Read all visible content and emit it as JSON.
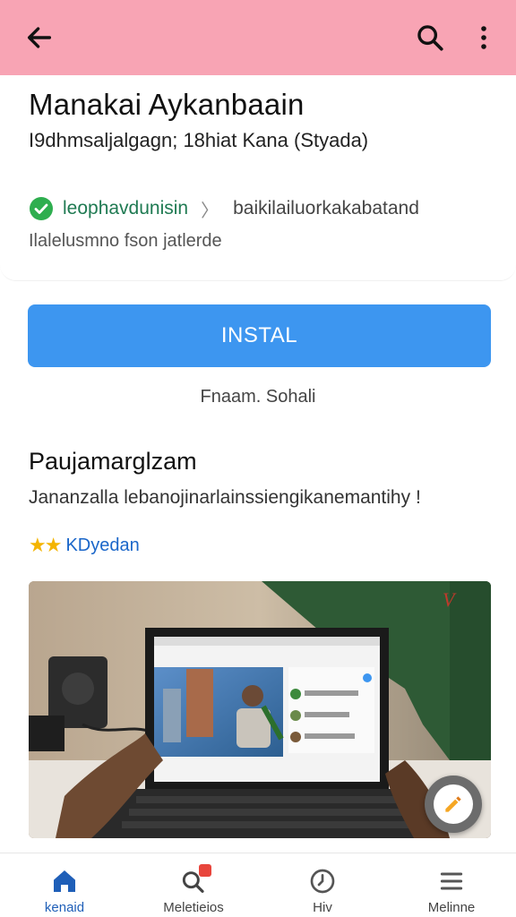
{
  "appbar": {
    "back_icon": "arrow-left-icon",
    "search_icon": "search-icon",
    "more_icon": "more-vertical-icon",
    "color": "#f8a4b4"
  },
  "app": {
    "title": "Manakai Aykanbaain",
    "subtitle": "I9dhmsaljalgagn; 18hiat Kana (Styada)",
    "developer": "leophavdunisin",
    "developer_tail": "baikilailuorkakabatand",
    "note": "Ilalelusmno fson jatlerde",
    "verified_icon": "check-circle-icon"
  },
  "install": {
    "label": "INSTAL",
    "caption": "Fnaam. Sohali",
    "color": "#3d96f0"
  },
  "section": {
    "title": "Paujamarglzam",
    "description": "Jananzalla lebanojinarlainssiengikanemantihy !",
    "rating_label": "KDyedan",
    "rating_stars": 2
  },
  "hero": {
    "logo_text": "V",
    "fab_icon": "pencil-icon"
  },
  "bottom_nav": {
    "items": [
      {
        "label": "kenaid",
        "icon": "home-icon"
      },
      {
        "label": "Meletieios",
        "icon": "search-badge-icon"
      },
      {
        "label": "Hiv",
        "icon": "clock-icon"
      },
      {
        "label": "Melinne",
        "icon": "menu-icon"
      }
    ]
  }
}
